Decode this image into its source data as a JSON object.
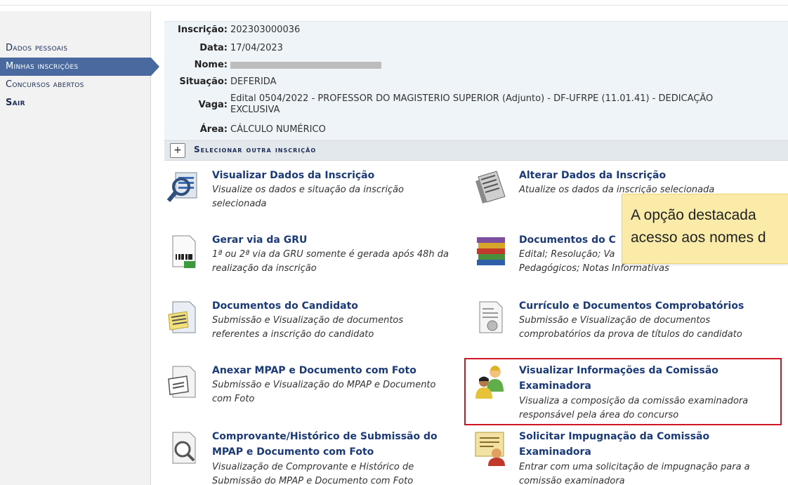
{
  "sidebar": {
    "items": [
      {
        "label": "Dados pessoais"
      },
      {
        "label": "Minhas inscrições"
      },
      {
        "label": "Concursos abertos"
      },
      {
        "label": "Sair"
      }
    ]
  },
  "inscricao": {
    "inscricao_label": "Inscrição:",
    "inscricao_value": "202303000036",
    "data_label": "Data:",
    "data_value": "17/04/2023",
    "nome_label": "Nome:",
    "situacao_label": "Situação:",
    "situacao_value": "DEFERIDA",
    "vaga_label": "Vaga:",
    "vaga_line1": "Edital 0504/2022 - PROFESSOR DO MAGISTERIO SUPERIOR (Adjunto) - DF-UFRPE (11.01.41) - DEDICAÇÃO",
    "vaga_line2": "EXCLUSIVA",
    "area_label": "Área:",
    "area_value": "CÁLCULO NUMÉRICO"
  },
  "select_other": {
    "plus": "+",
    "label": "Selecionar outra inscrição"
  },
  "options": [
    {
      "icon": "magnifier-data-icon",
      "title": "Visualizar Dados da Inscrição",
      "desc1": "Visualize os dados e situação da inscrição",
      "desc2": "selecionada"
    },
    {
      "icon": "edit-document-icon",
      "title": "Alterar Dados da Inscrição",
      "desc1": "Atualize os dados da inscrição selecionada",
      "desc2": ""
    },
    {
      "icon": "barcode-document-icon",
      "title": "Gerar via da GRU",
      "desc1": "1ª ou 2ª via da GRU somente é gerada após 48h da",
      "desc2": "realização da inscrição"
    },
    {
      "icon": "books-icon",
      "title": "Documentos do C",
      "desc1": "Edital; Resolução; Va",
      "desc2": "Pedagógicos; Notas Informativas"
    },
    {
      "icon": "document-note-icon",
      "title": "Documentos do Candidato",
      "desc1": "Submissão e Visualização de documentos",
      "desc2": "referentes a inscrição do candidato"
    },
    {
      "icon": "certificate-document-icon",
      "title": "Currículo e Documentos Comprobatórios",
      "desc1": "Submissão e Visualização de documentos",
      "desc2": "comprobatórios da prova de títulos do candidato"
    },
    {
      "icon": "attach-document-icon",
      "title": "Anexar MPAP e Documento com Foto",
      "desc1": "Submissão e Visualização do MPAP e Documento",
      "desc2": "com Foto"
    },
    {
      "icon": "users-group-icon",
      "title": "Visualizar Informações da Comissão",
      "title2": "Examinadora",
      "desc1": "Visualiza a composição da comissão examinadora",
      "desc2": "responsável pela área do concurso"
    },
    {
      "icon": "search-document-icon",
      "title": "Comprovante/Histórico de Submissão do",
      "title2": "MPAP e Documento com Foto",
      "desc1": "Visualização de Comprovante e Histórico de",
      "desc2": "Submissão do MPAP e Documento com Foto"
    },
    {
      "icon": "certificate-person-icon",
      "title": "Solicitar Impugnação da Comissão",
      "title2": "Examinadora",
      "desc1": "Entrar com uma solicitação de impugnação para a",
      "desc2": "comissão examinadora"
    }
  ],
  "tooltip": {
    "line1": "A opção destacada",
    "line2": "acesso aos nomes d"
  }
}
